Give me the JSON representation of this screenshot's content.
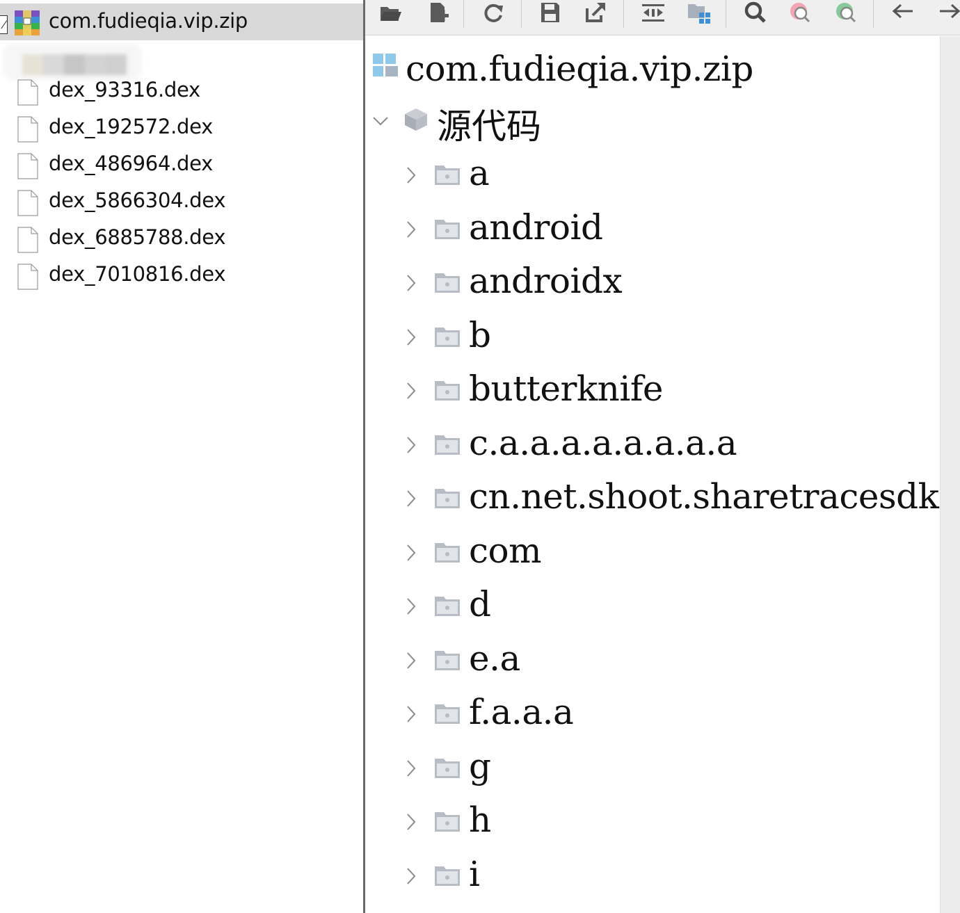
{
  "left_panel": {
    "title": "com.fudieqia.vip.zip",
    "files": [
      {
        "name": "dex_93316.dex"
      },
      {
        "name": "dex_192572.dex"
      },
      {
        "name": "dex_486964.dex"
      },
      {
        "name": "dex_5866304.dex"
      },
      {
        "name": "dex_6885788.dex"
      },
      {
        "name": "dex_7010816.dex"
      }
    ]
  },
  "toolbar": {
    "buttons": [
      {
        "icon": "open-folder-icon"
      },
      {
        "icon": "add-file-icon"
      },
      {
        "icon": "reload-icon"
      },
      {
        "icon": "save-icon"
      },
      {
        "icon": "export-icon"
      },
      {
        "icon": "sync-icon"
      },
      {
        "icon": "flatten-packages-icon"
      },
      {
        "icon": "search-icon"
      },
      {
        "icon": "find-class-icon"
      },
      {
        "icon": "find-usage-icon"
      },
      {
        "icon": "back-arrow-icon"
      },
      {
        "icon": "forward-arrow-icon"
      }
    ]
  },
  "tree": {
    "root_label": "com.fudieqia.vip.zip",
    "source_label": "源代码",
    "packages": [
      {
        "label": "a"
      },
      {
        "label": "android"
      },
      {
        "label": "androidx"
      },
      {
        "label": "b"
      },
      {
        "label": "butterknife"
      },
      {
        "label": "c.a.a.a.a.a.a.a.a"
      },
      {
        "label": "cn.net.shoot.sharetracesdk"
      },
      {
        "label": "com"
      },
      {
        "label": "d"
      },
      {
        "label": "e.a"
      },
      {
        "label": "f.a.a.a"
      },
      {
        "label": "g"
      },
      {
        "label": "h"
      },
      {
        "label": "i"
      }
    ]
  },
  "colors": {
    "folder_gray": "#b8bcc4",
    "toolbar_icon": "#5a5a5a",
    "root_icon_blue": "#6fa8dc",
    "header_bg": "#d9d9d9"
  }
}
